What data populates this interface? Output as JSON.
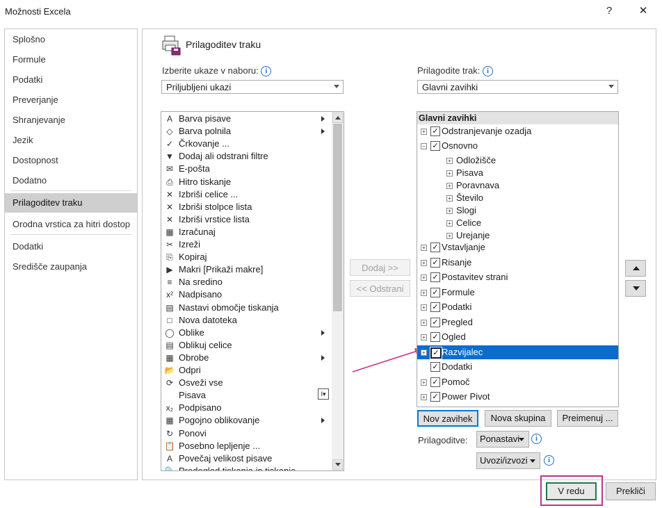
{
  "window": {
    "title": "Možnosti Excela",
    "help": "?",
    "close": "✕"
  },
  "nav": {
    "items": [
      "Splošno",
      "Formule",
      "Podatki",
      "Preverjanje",
      "Shranjevanje",
      "Jezik",
      "Dostopnost",
      "Dodatno",
      "Prilagoditev traku",
      "Orodna vrstica za hitri dostop",
      "Dodatki",
      "Središče zaupanja"
    ],
    "active_index": 8
  },
  "main": {
    "heading": "Prilagoditev traku",
    "choose_label": "Izberite ukaze v naboru:",
    "choose_value": "Priljubljeni ukazi",
    "customize_label": "Prilagodite trak:",
    "customize_value": "Glavni zavihki"
  },
  "commands": [
    {
      "icon": "A",
      "label": "Barva pisave",
      "sub": true
    },
    {
      "icon": "◇",
      "label": "Barva polnila",
      "sub": true
    },
    {
      "icon": "✓",
      "label": "Črkovanje ..."
    },
    {
      "icon": "▼",
      "label": "Dodaj ali odstrani filtre"
    },
    {
      "icon": "✉",
      "label": "E-pošta"
    },
    {
      "icon": "⎙",
      "label": "Hitro tiskanje"
    },
    {
      "icon": "✕",
      "label": "Izbriši celice ..."
    },
    {
      "icon": "✕",
      "label": "Izbriši stolpce lista"
    },
    {
      "icon": "✕",
      "label": "Izbriši vrstice lista"
    },
    {
      "icon": "▦",
      "label": "Izračunaj"
    },
    {
      "icon": "✂",
      "label": "Izreži"
    },
    {
      "icon": "⎘",
      "label": "Kopiraj"
    },
    {
      "icon": "▶",
      "label": "Makri [Prikaži makre]"
    },
    {
      "icon": "≡",
      "label": "Na sredino"
    },
    {
      "icon": "x²",
      "label": "Nadpisano"
    },
    {
      "icon": "▤",
      "label": "Nastavi območje tiskanja"
    },
    {
      "icon": "□",
      "label": "Nova datoteka"
    },
    {
      "icon": "◯",
      "label": "Oblike",
      "sub": true
    },
    {
      "icon": "▤",
      "label": "Oblikuj celice"
    },
    {
      "icon": "▦",
      "label": "Obrobe",
      "sub": true
    },
    {
      "icon": "📂",
      "label": "Odpri"
    },
    {
      "icon": "⟳",
      "label": "Osveži vse"
    },
    {
      "icon": "",
      "label": "Pisava"
    },
    {
      "icon": "x₂",
      "label": "Podpisano"
    },
    {
      "icon": "▦",
      "label": "Pogojno oblikovanje",
      "sub": true
    },
    {
      "icon": "↻",
      "label": "Ponovi"
    },
    {
      "icon": "📋",
      "label": "Posebno lepljenje ..."
    },
    {
      "icon": "A",
      "label": "Povečaj velikost pisave"
    },
    {
      "icon": "🔍",
      "label": "Predogled tiskanja in tiskanje"
    }
  ],
  "buttons": {
    "add": "Dodaj >>",
    "remove": "<< Odstrani",
    "new_tab": "Nov zavihek",
    "new_group": "Nova skupina",
    "rename": "Preimenuj ...",
    "customizations_label": "Prilagoditve:",
    "reset": "Ponastavi",
    "import_export": "Uvozi/izvozi",
    "ok": "V redu",
    "cancel": "Prekliči"
  },
  "tree": {
    "header": "Glavni zavihki",
    "items": [
      {
        "label": "Odstranjevanje ozadja",
        "level": 0,
        "exp": "+",
        "checked": true
      },
      {
        "label": "Osnovno",
        "level": 0,
        "exp": "−",
        "checked": true
      },
      {
        "label": "Odložišče",
        "level": 1,
        "exp": "+"
      },
      {
        "label": "Pisava",
        "level": 1,
        "exp": "+"
      },
      {
        "label": "Poravnava",
        "level": 1,
        "exp": "+"
      },
      {
        "label": "Število",
        "level": 1,
        "exp": "+"
      },
      {
        "label": "Slogi",
        "level": 1,
        "exp": "+"
      },
      {
        "label": "Celice",
        "level": 1,
        "exp": "+"
      },
      {
        "label": "Urejanje",
        "level": 1,
        "exp": "+"
      },
      {
        "label": "Vstavljanje",
        "level": 0,
        "exp": "+",
        "checked": true
      },
      {
        "label": "Risanje",
        "level": 0,
        "exp": "+",
        "checked": true
      },
      {
        "label": "Postavitev strani",
        "level": 0,
        "exp": "+",
        "checked": true
      },
      {
        "label": "Formule",
        "level": 0,
        "exp": "+",
        "checked": true
      },
      {
        "label": "Podatki",
        "level": 0,
        "exp": "+",
        "checked": true
      },
      {
        "label": "Pregled",
        "level": 0,
        "exp": "+",
        "checked": true
      },
      {
        "label": "Ogled",
        "level": 0,
        "exp": "+",
        "checked": true
      },
      {
        "label": "Razvijalec",
        "level": 0,
        "exp": "+",
        "checked": true,
        "selected": true
      },
      {
        "label": "Dodatki",
        "level": 0,
        "exp": "",
        "checked": true
      },
      {
        "label": "Pomoč",
        "level": 0,
        "exp": "+",
        "checked": true
      },
      {
        "label": "Power Pivot",
        "level": 0,
        "exp": "+",
        "checked": true
      }
    ]
  },
  "colors": {
    "selection": "#0a6ccf",
    "annotation": "#c4308c",
    "ok_border": "#1f7a47"
  }
}
